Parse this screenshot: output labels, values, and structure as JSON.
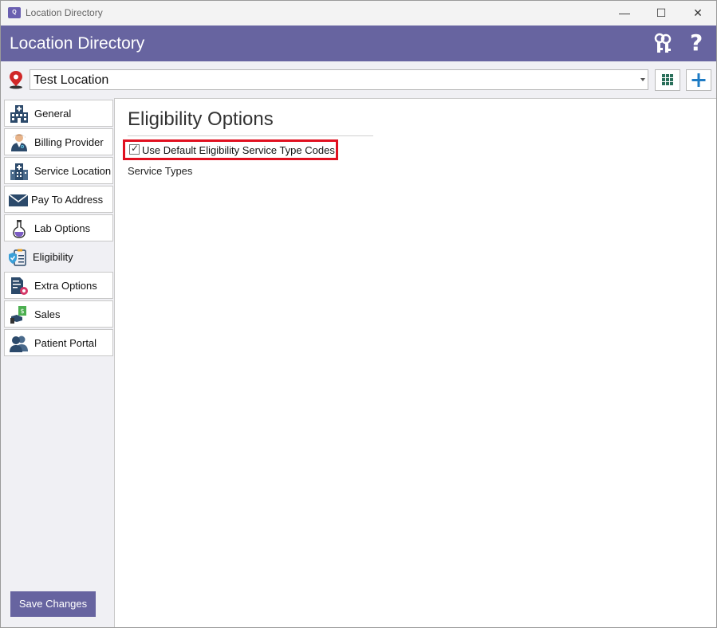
{
  "window": {
    "title": "Location Directory",
    "icon_text": "Q",
    "controls": {
      "minimize": "—",
      "maximize": "☐",
      "close": "✕"
    }
  },
  "header": {
    "title": "Location Directory",
    "keys_icon": "keys-icon",
    "help_label": "?"
  },
  "location": {
    "selected": "Test Location"
  },
  "sidebar": {
    "items": [
      {
        "label": "General",
        "icon": "hospital-icon"
      },
      {
        "label": "Billing Provider",
        "icon": "doctor-icon"
      },
      {
        "label": "Service Location",
        "icon": "building-icon"
      },
      {
        "label": "Pay To Address",
        "icon": "envelope-icon"
      },
      {
        "label": "Lab Options",
        "icon": "flask-icon"
      },
      {
        "label": "Eligibility",
        "icon": "shield-clipboard-icon",
        "active": true
      },
      {
        "label": "Extra Options",
        "icon": "document-gear-icon"
      },
      {
        "label": "Sales",
        "icon": "money-hand-icon"
      },
      {
        "label": "Patient Portal",
        "icon": "users-icon"
      }
    ],
    "save_label": "Save Changes"
  },
  "main": {
    "title": "Eligibility Options",
    "checkbox": {
      "label": "Use Default Eligibility Service Type Codes",
      "checked": true
    },
    "service_types_label": "Service Types"
  },
  "colors": {
    "header": "#6764a0",
    "highlight": "#e01020",
    "add_icon": "#1e7bc4"
  }
}
